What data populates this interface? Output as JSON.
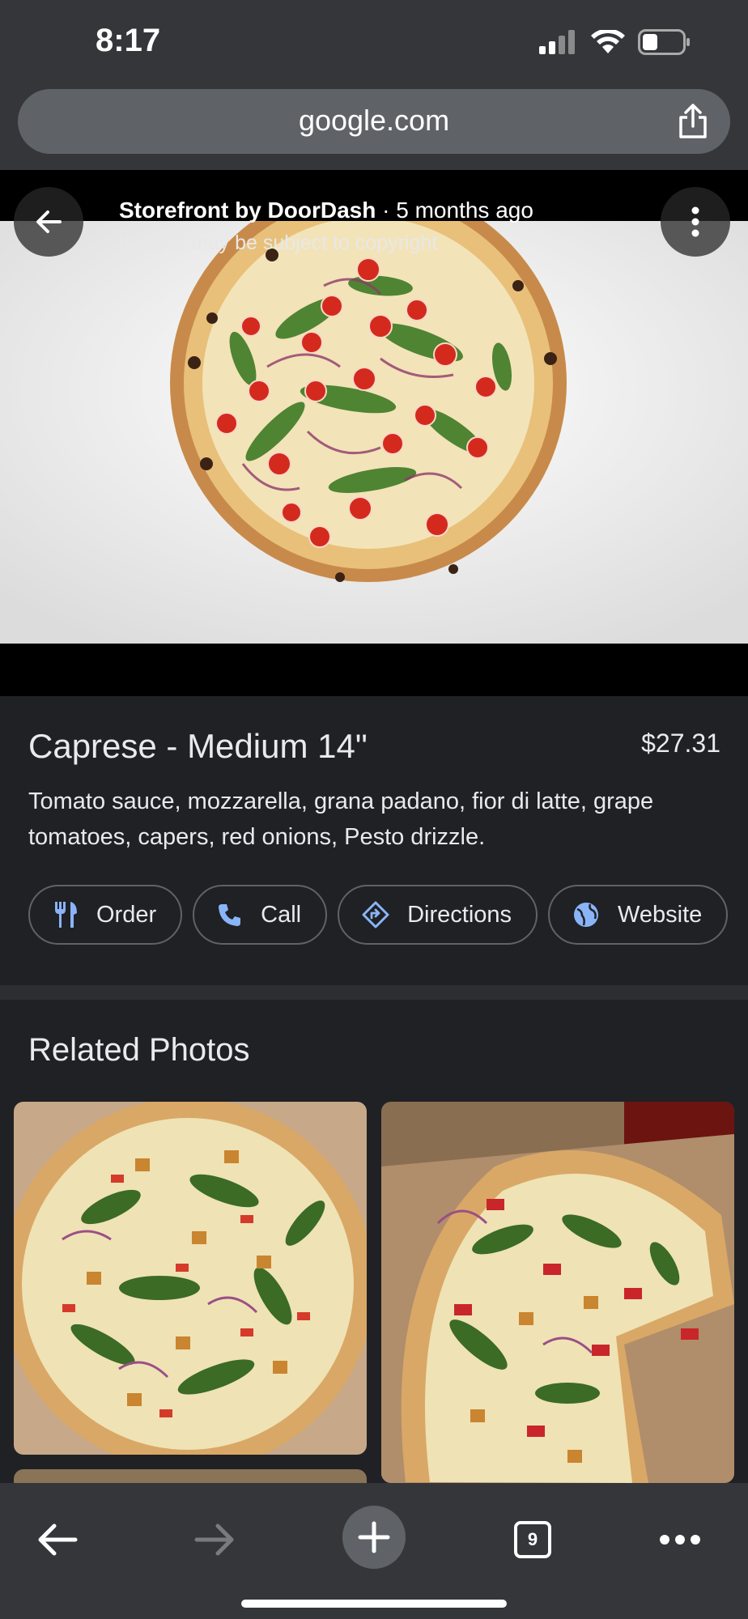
{
  "status_bar": {
    "time": "8:17"
  },
  "address_bar": {
    "url": "google.com"
  },
  "image_viewer": {
    "source_name": "Storefront by DoorDash",
    "separator": " · ",
    "age": "5 months ago",
    "copyright_note": "Images may be subject to copyright"
  },
  "item": {
    "title": "Caprese - Medium 14\"",
    "price": "$27.31",
    "description": "Tomato sauce, mozzarella, grana padano, fior di latte, grape tomatoes, capers, red onions, Pesto drizzle."
  },
  "actions": [
    {
      "label": "Order",
      "icon": "restaurant-icon"
    },
    {
      "label": "Call",
      "icon": "phone-icon"
    },
    {
      "label": "Directions",
      "icon": "directions-icon"
    },
    {
      "label": "Website",
      "icon": "globe-icon"
    }
  ],
  "related": {
    "heading": "Related Photos"
  },
  "bottom_nav": {
    "tab_count": "9"
  },
  "colors": {
    "accent": "#8ab4f8",
    "background": "#202124",
    "toolbar": "#35363a"
  }
}
